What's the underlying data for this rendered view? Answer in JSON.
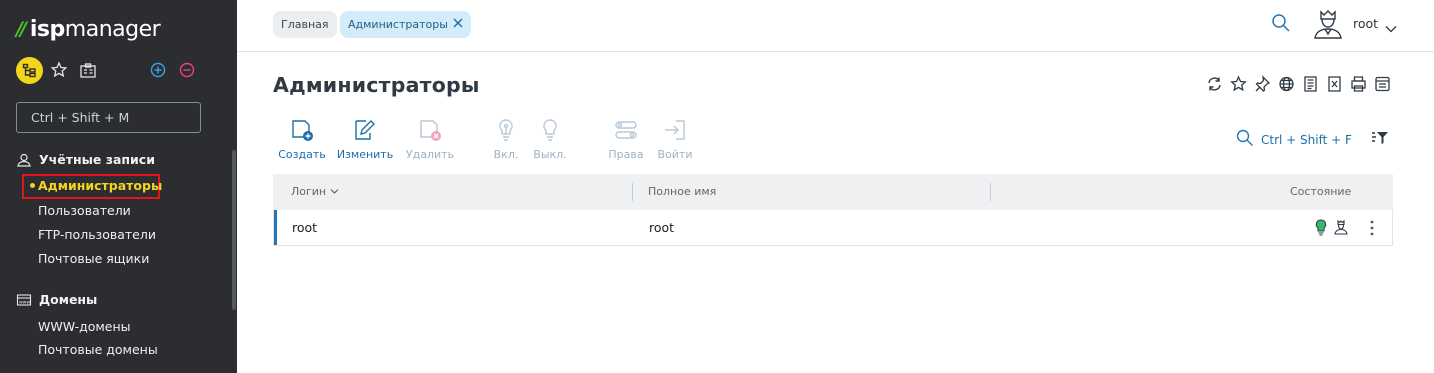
{
  "app": {
    "logo_isp": "isp",
    "logo_manager": "manager"
  },
  "sidebar": {
    "search_placeholder": "Ctrl + Shift + M",
    "groups": [
      {
        "label": "Учётные записи",
        "icon": "user-accounts-icon",
        "items": [
          {
            "label": "Администраторы",
            "active": true
          },
          {
            "label": "Пользователи"
          },
          {
            "label": "FTP-пользователи"
          },
          {
            "label": "Почтовые ящики"
          }
        ]
      },
      {
        "label": "Домены",
        "icon": "domains-icon",
        "items": [
          {
            "label": "WWW-домены"
          },
          {
            "label": "Почтовые домены"
          }
        ]
      }
    ]
  },
  "breadcrumbs": [
    {
      "label": "Главная"
    },
    {
      "label": "Администраторы"
    }
  ],
  "user": {
    "name": "root"
  },
  "page": {
    "title": "Администраторы"
  },
  "toolbar": {
    "create": "Создать",
    "edit": "Изменить",
    "delete": "Удалить",
    "enable": "Вкл.",
    "disable": "Выкл.",
    "rights": "Права",
    "login": "Войти",
    "search_shortcut": "Ctrl + Shift + F"
  },
  "table": {
    "columns": [
      "Логин",
      "Полное имя",
      "Состояние"
    ],
    "rows": [
      {
        "login": "root",
        "full_name": "root",
        "state": "enabled"
      }
    ]
  },
  "colors": {
    "sidebar_bg": "#2b2d30",
    "accent_yellow": "#f3d61c",
    "accent_blue": "#1d6fa8",
    "logo_green": "#4bc02a",
    "highlight_red": "#e3141b"
  }
}
